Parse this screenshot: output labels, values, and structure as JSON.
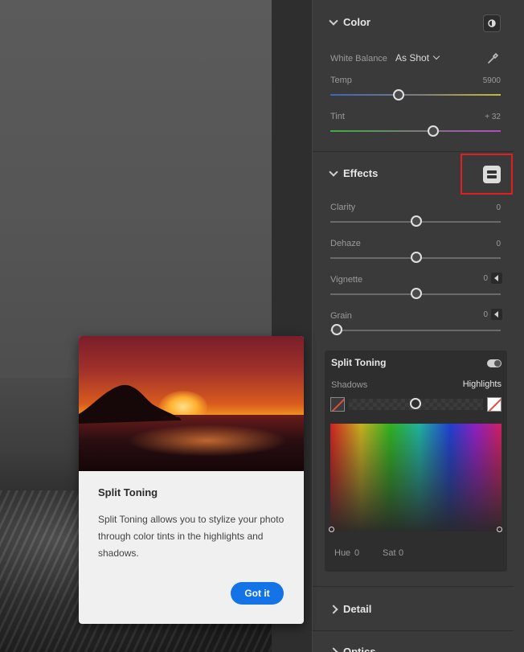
{
  "panel": {
    "color": {
      "title": "Color",
      "white_balance_label": "White Balance",
      "white_balance_value": "As Shot",
      "temp_label": "Temp",
      "temp_value": "5900",
      "tint_label": "Tint",
      "tint_value": "+ 32"
    },
    "effects": {
      "title": "Effects",
      "clarity_label": "Clarity",
      "clarity_value": "0",
      "dehaze_label": "Dehaze",
      "dehaze_value": "0",
      "vignette_label": "Vignette",
      "vignette_value": "0",
      "grain_label": "Grain",
      "grain_value": "0"
    },
    "split_toning": {
      "title": "Split Toning",
      "shadows_label": "Shadows",
      "highlights_label": "Highlights",
      "hue_label": "Hue",
      "hue_value": "0",
      "sat_label": "Sat",
      "sat_value": "0"
    },
    "detail": {
      "title": "Detail"
    },
    "optics": {
      "title": "Optics"
    }
  },
  "popup": {
    "title": "Split Toning",
    "text": "Split Toning allows you to stylize your photo through color tints in the highlights and shadows.",
    "button": "Got it"
  },
  "colors": {
    "accent": "#1473e6",
    "highlight_box": "#e02020",
    "panel_bg": "#3a3a3a"
  }
}
